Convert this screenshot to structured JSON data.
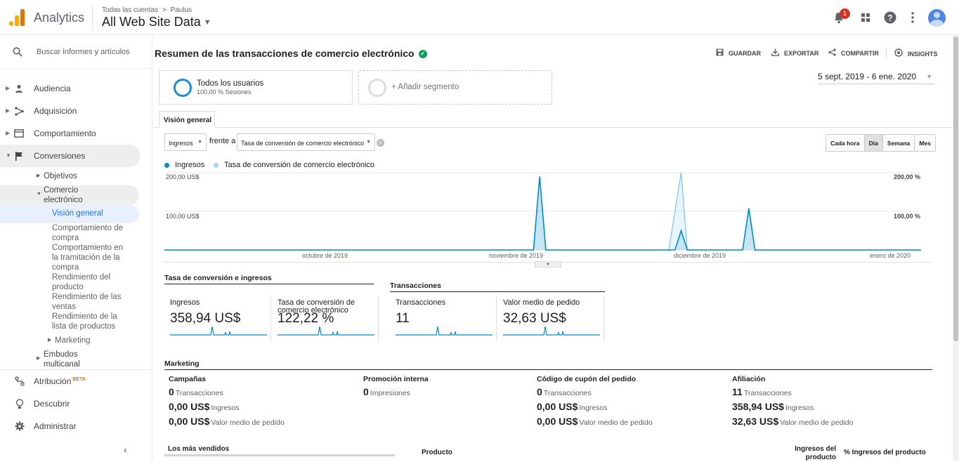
{
  "header": {
    "app_name": "Analytics",
    "breadcrumb_accounts": "Todas las cuentas",
    "breadcrumb_separator": ">",
    "breadcrumb_property": "Paulus",
    "view_name": "All Web Site Data",
    "notification_count": "1"
  },
  "sidebar": {
    "search_placeholder": "Buscar informes y artículos",
    "items": [
      {
        "label": "Audiencia",
        "icon": "person-icon"
      },
      {
        "label": "Adquisición",
        "icon": "acquisition-icon"
      },
      {
        "label": "Comportamiento",
        "icon": "behavior-icon"
      },
      {
        "label": "Conversiones",
        "icon": "flag-icon"
      }
    ],
    "conversions_sub": {
      "objetivos": "Objetivos",
      "comercio": "Comercio electrónico",
      "vision_general": "Visión general",
      "comportamiento_compra": "Comportamiento de compra",
      "comportamiento_tramitacion": "Comportamiento en la tramitación de la compra",
      "rendimiento_producto": "Rendimiento del producto",
      "rendimiento_ventas": "Rendimiento de las ventas",
      "rendimiento_lista": "Rendimiento de la lista de productos",
      "marketing": "Marketing",
      "embudos": "Embudos multicanal"
    },
    "bottom": [
      {
        "label": "Atribución",
        "badge": "BETA",
        "icon": "attribution-icon"
      },
      {
        "label": "Descubrir",
        "icon": "lightbulb-icon"
      },
      {
        "label": "Administrar",
        "icon": "gear-icon"
      }
    ]
  },
  "main": {
    "title": "Resumen de las transacciones de comercio electrónico",
    "actions": {
      "save": "GUARDAR",
      "export": "EXPORTAR",
      "share": "COMPARTIR",
      "insights": "INSIGHTS"
    },
    "segment": {
      "name": "Todos los usuarios",
      "sub": "100,00 % Sesiones",
      "add": "+ Añadir segmento"
    },
    "date_range": "5 sept. 2019 - 6 ene. 2020",
    "tab": "Visión general",
    "metric1": "Ingresos",
    "versus": "frente a",
    "metric2": "Tasa de conversión de comercio electrónico",
    "granularity": [
      "Cada hora",
      "Día",
      "Semana",
      "Mes"
    ],
    "legend": {
      "series1": "Ingresos",
      "series2": "Tasa de conversión de comercio electrónico"
    },
    "colors": {
      "series1": "#058dc7",
      "series2": "#7fc7ea",
      "accent": "#1a73e8"
    }
  },
  "chart_data": {
    "type": "area",
    "x_labels": [
      "octubre de 2019",
      "noviembre de 2019",
      "diciembre de 2019",
      "enero de 2020"
    ],
    "y_left_ticks": [
      "200,00 US$",
      "100,00 US$"
    ],
    "y_right_ticks": [
      "200,00 %",
      "100,00 %"
    ],
    "ylim_left": [
      0,
      200
    ],
    "ylim_right": [
      0,
      200
    ],
    "days": 124,
    "series": [
      {
        "name": "Ingresos",
        "points": [
          [
            0,
            0
          ],
          [
            60,
            0
          ],
          [
            61,
            190
          ],
          [
            62,
            0
          ],
          [
            83,
            0
          ],
          [
            84,
            50
          ],
          [
            85,
            0
          ],
          [
            94,
            0
          ],
          [
            95,
            108
          ],
          [
            96,
            0
          ],
          [
            123,
            0
          ]
        ]
      },
      {
        "name": "Tasa de conversión de comercio electrónico",
        "points": [
          [
            0,
            0
          ],
          [
            60,
            0
          ],
          [
            61,
            190
          ],
          [
            62,
            0
          ],
          [
            82,
            0
          ],
          [
            84,
            200
          ],
          [
            85,
            0
          ],
          [
            94,
            0
          ],
          [
            95,
            108
          ],
          [
            96,
            0
          ],
          [
            123,
            0
          ]
        ]
      }
    ]
  },
  "kpis": {
    "section1": "Tasa de conversión e ingresos",
    "section2": "Transacciones",
    "tiles": [
      {
        "label": "Ingresos",
        "value": "358,94 US$"
      },
      {
        "label": "Tasa de conversión de comercio electrónico",
        "value": "122,22 %"
      },
      {
        "label": "Transacciones",
        "value": "11"
      },
      {
        "label": "Valor medio de pedido",
        "value": "32,63 US$"
      }
    ]
  },
  "marketing": {
    "title": "Marketing",
    "columns": [
      {
        "head": "Campañas",
        "rows": [
          {
            "v": "0",
            "l": "Transacciones"
          },
          {
            "v": "0,00 US$",
            "l": "Ingresos"
          },
          {
            "v": "0,00 US$",
            "l": "Valor medio de pedido"
          }
        ]
      },
      {
        "head": "Promoción interna",
        "rows": [
          {
            "v": "0",
            "l": "Impresiones"
          }
        ]
      },
      {
        "head": "Código de cupón del pedido",
        "rows": [
          {
            "v": "0",
            "l": "Transacciones"
          },
          {
            "v": "0,00 US$",
            "l": "Ingresos"
          },
          {
            "v": "0,00 US$",
            "l": "Valor medio de pedido"
          }
        ]
      },
      {
        "head": "Afiliación",
        "rows": [
          {
            "v": "11",
            "l": "Transacciones"
          },
          {
            "v": "358,94 US$",
            "l": "Ingresos"
          },
          {
            "v": "32,63 US$",
            "l": "Valor medio de pedido"
          }
        ]
      }
    ]
  },
  "bottom_table": {
    "best_sellers": "Los más vendidos",
    "product": "Producto",
    "product_revenue": "Ingresos del producto",
    "pct_revenue": "% Ingresos del producto"
  }
}
